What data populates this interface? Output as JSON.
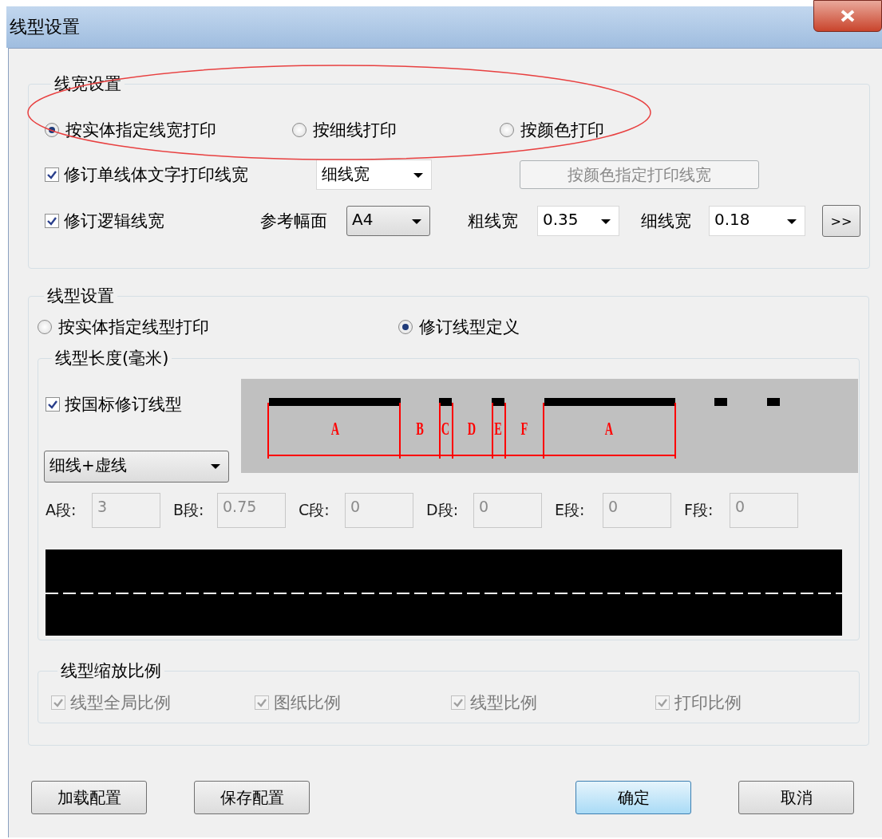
{
  "window": {
    "title": "线型设置"
  },
  "line_width": {
    "title": "线宽设置",
    "modes": [
      {
        "label": "按实体指定线宽打印",
        "selected": true
      },
      {
        "label": "按细线打印",
        "selected": false
      },
      {
        "label": "按颜色打印",
        "selected": false
      }
    ],
    "revise_text": {
      "label": "修订单线体文字打印线宽",
      "checked": true,
      "value": "细线宽"
    },
    "color_button": {
      "label": "按颜色指定打印线宽",
      "disabled": true
    },
    "revise_logic": {
      "label": "修订逻辑线宽",
      "checked": true
    },
    "paper": {
      "label": "参考幅面",
      "value": "A4"
    },
    "thick": {
      "label": "粗线宽",
      "value": "0.35"
    },
    "thin": {
      "label": "细线宽",
      "value": "0.18"
    },
    "more_button": ">>"
  },
  "line_type": {
    "title": "线型设置",
    "modes": [
      {
        "label": "按实体指定线型打印",
        "selected": false
      },
      {
        "label": "修订线型定义",
        "selected": true
      }
    ],
    "length": {
      "title": "线型长度(毫米)",
      "gb": {
        "label": "按国标修订线型",
        "checked": true
      },
      "type": "细线+虚线",
      "preview_labels": [
        "A",
        "B",
        "C",
        "D",
        "E",
        "F",
        "A"
      ],
      "segments": [
        {
          "label": "A段:",
          "value": "3",
          "disabled": true
        },
        {
          "label": "B段:",
          "value": "0.75",
          "disabled": true
        },
        {
          "label": "C段:",
          "value": "0",
          "disabled": true
        },
        {
          "label": "D段:",
          "value": "0",
          "disabled": true
        },
        {
          "label": "E段:",
          "value": "0",
          "disabled": true
        },
        {
          "label": "F段:",
          "value": "0",
          "disabled": true
        }
      ]
    },
    "scale": {
      "title": "线型缩放比例",
      "options": [
        {
          "label": "线型全局比例",
          "checked": true,
          "disabled": true
        },
        {
          "label": "图纸比例",
          "checked": true,
          "disabled": true
        },
        {
          "label": "线型比例",
          "checked": true,
          "disabled": true
        },
        {
          "label": "打印比例",
          "checked": true,
          "disabled": true
        }
      ]
    }
  },
  "buttons": [
    {
      "label": "加载配置",
      "kind": "normal"
    },
    {
      "label": "保存配置",
      "kind": "normal"
    },
    {
      "label": "确定",
      "kind": "default"
    },
    {
      "label": "取消",
      "kind": "normal"
    }
  ]
}
